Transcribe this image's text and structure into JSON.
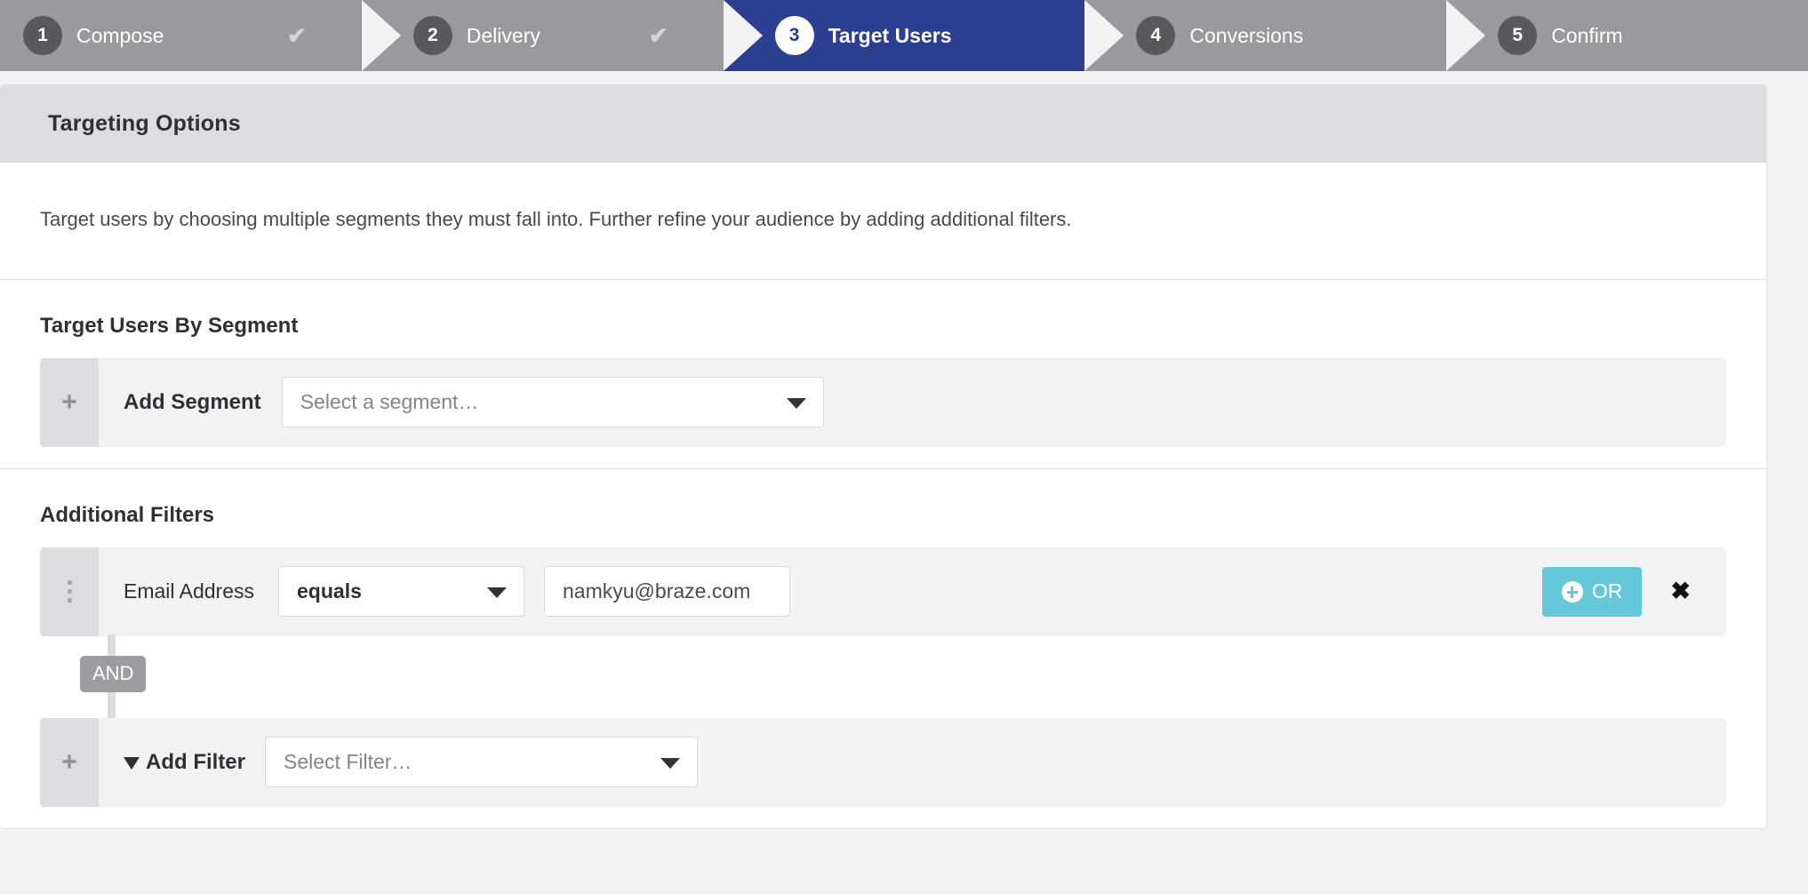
{
  "wizard": {
    "steps": [
      {
        "number": "1",
        "label": "Compose",
        "state": "complete",
        "check": "✔"
      },
      {
        "number": "2",
        "label": "Delivery",
        "state": "complete",
        "check": "✔"
      },
      {
        "number": "3",
        "label": "Target Users",
        "state": "active",
        "check": ""
      },
      {
        "number": "4",
        "label": "Conversions",
        "state": "upcoming",
        "check": ""
      },
      {
        "number": "5",
        "label": "Confirm",
        "state": "upcoming",
        "check": ""
      }
    ],
    "active_color": "#2c3e8f",
    "inactive_color": "#999a9d",
    "badge_color": "#58595c"
  },
  "card": {
    "header_title": "Targeting Options",
    "intro_text": "Target users by choosing multiple segments they must fall into. Further refine your audience by adding additional filters.",
    "segment_section": {
      "title": "Target Users By Segment",
      "handle_icon": "plus-icon",
      "add_label": "Add Segment",
      "select_placeholder": "Select a segment…",
      "caret_icon": "chevron-down-icon"
    },
    "filters_section": {
      "title": "Additional Filters",
      "filter_row": {
        "handle_icon": "drag-handle-icon",
        "field_label": "Email Address",
        "operator_value": "equals",
        "operator_caret_icon": "chevron-down-icon",
        "value_text": "namkyu@braze.com",
        "or_button_label": "OR",
        "or_button_icon": "plus-circle-icon",
        "or_button_color": "#65c8d9",
        "remove_icon": "close-icon",
        "remove_glyph": "✖"
      },
      "connector_label": "AND",
      "connector_color": "#9c9da0",
      "add_filter_row": {
        "handle_icon": "plus-icon",
        "funnel_icon": "funnel-icon",
        "add_label": "Add Filter",
        "select_placeholder": "Select Filter…",
        "caret_icon": "chevron-down-icon"
      }
    }
  }
}
